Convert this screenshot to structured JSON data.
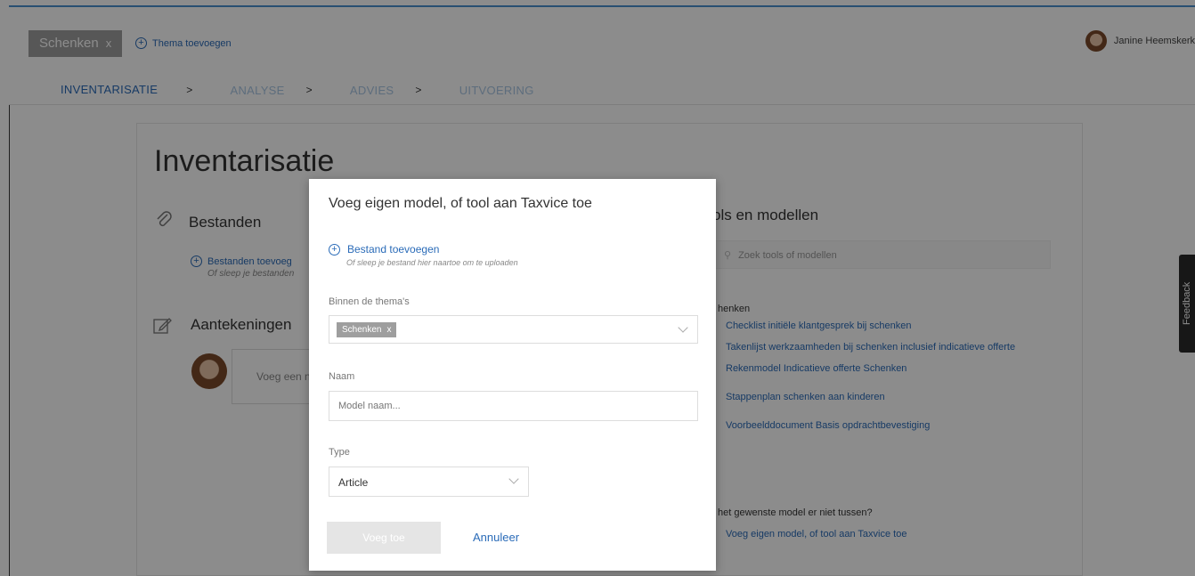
{
  "header": {
    "theme_chip": "Schenken",
    "theme_chip_remove": "x",
    "add_theme": "Thema toevoegen",
    "user_name": "Janine Heemskerk"
  },
  "steps": [
    {
      "label": "INVENTARISATIE"
    },
    {
      "label": "ANALYSE"
    },
    {
      "label": "ADVIES"
    },
    {
      "label": "UITVOERING"
    }
  ],
  "step_separator": ">",
  "page": {
    "title": "Inventarisatie",
    "files_title": "Bestanden",
    "files_add": "Bestanden toevoeg",
    "files_hint": "Of sleep je bestanden",
    "notes_title": "Aantekeningen",
    "notes_placeholder": "Voeg een n"
  },
  "tools": {
    "title": "ols en modellen",
    "search_placeholder": "Zoek tools of modellen",
    "category": "henken",
    "items": [
      "Checklist initiële klantgesprek bij schenken",
      "Takenlijst werkzaamheden bij schenken inclusief indicatieve offerte",
      "Rekenmodel Indicatieve offerte Schenken",
      "Stappenplan schenken aan kinderen",
      "Voorbeelddocument Basis opdrachtbevestiging"
    ],
    "missing_question": "het gewenste model er niet tussen?",
    "missing_link": "Voeg eigen model, of tool aan Taxvice toe"
  },
  "feedback_tab": "Feedback",
  "modal": {
    "title": "Voeg eigen model, of tool aan Taxvice toe",
    "upload_label": "Bestand toevoegen",
    "upload_hint": "Of sleep je bestand hier naartoe om te uploaden",
    "themes_label": "Binnen de thema's",
    "themes_chip": "Schenken",
    "themes_chip_remove": "x",
    "name_label": "Naam",
    "name_placeholder": "Model naam...",
    "type_label": "Type",
    "type_value": "Article",
    "submit_label": "Voeg toe",
    "cancel_label": "Annuleer"
  },
  "colors": {
    "accent": "#2a6bb8",
    "chip": "#9e9e9e",
    "overlay": "rgba(0,0,0,0.45)"
  }
}
